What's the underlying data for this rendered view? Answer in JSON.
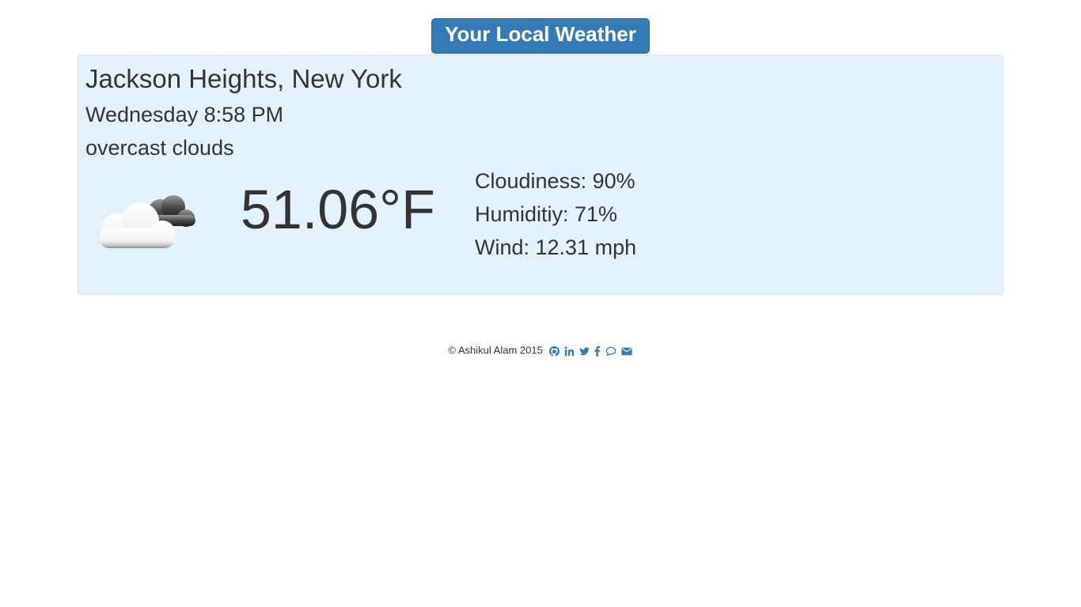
{
  "header": {
    "title": "Your Local Weather"
  },
  "weather": {
    "location": "Jackson Heights, New York",
    "datetime": "Wednesday 8:58 PM",
    "description": "overcast clouds",
    "icon": "overcast-clouds-icon",
    "temperature": "51.06°F",
    "cloudiness": "Cloudiness: 90%",
    "humidity": "Humiditiy: 71%",
    "wind": "Wind: 12.31 mph"
  },
  "footer": {
    "credit": "© Ashikul Alam 2015",
    "social_icons": [
      "github-icon",
      "linkedin-icon",
      "twitter-icon",
      "facebook-icon",
      "chat-icon",
      "email-icon"
    ]
  },
  "colors": {
    "accent": "#337ab7",
    "panel_background": "#e3f1fc",
    "text": "#333333"
  }
}
